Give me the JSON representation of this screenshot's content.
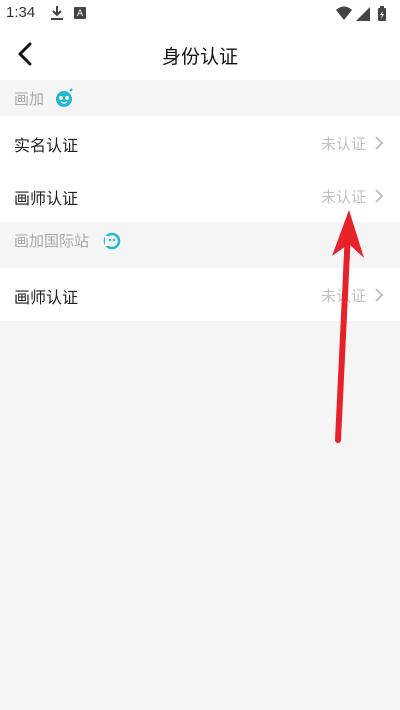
{
  "status_bar": {
    "time": "1:34",
    "notification_icons": [
      "download-icon",
      "a-icon"
    ],
    "system_icons": [
      "wifi-icon",
      "signal-icon",
      "battery-icon"
    ]
  },
  "header": {
    "title": "身份认证",
    "back_icon": "chevron-left-icon"
  },
  "sections": [
    {
      "title": "画加",
      "icon": "huajia-logo-icon",
      "rows": [
        {
          "label": "实名认证",
          "status": "未认证"
        },
        {
          "label": "画师认证",
          "status": "未认证"
        }
      ]
    },
    {
      "title": "画加国际站",
      "icon": "huajia-intl-logo-icon",
      "rows": [
        {
          "label": "画师认证",
          "status": "未认证"
        }
      ]
    }
  ],
  "colors": {
    "accent": "#22b8cf",
    "annotation_arrow": "#e8222a",
    "status_text": "#c2c2c2",
    "section_title": "#a8a8a8",
    "background": "#f5f5f5"
  }
}
